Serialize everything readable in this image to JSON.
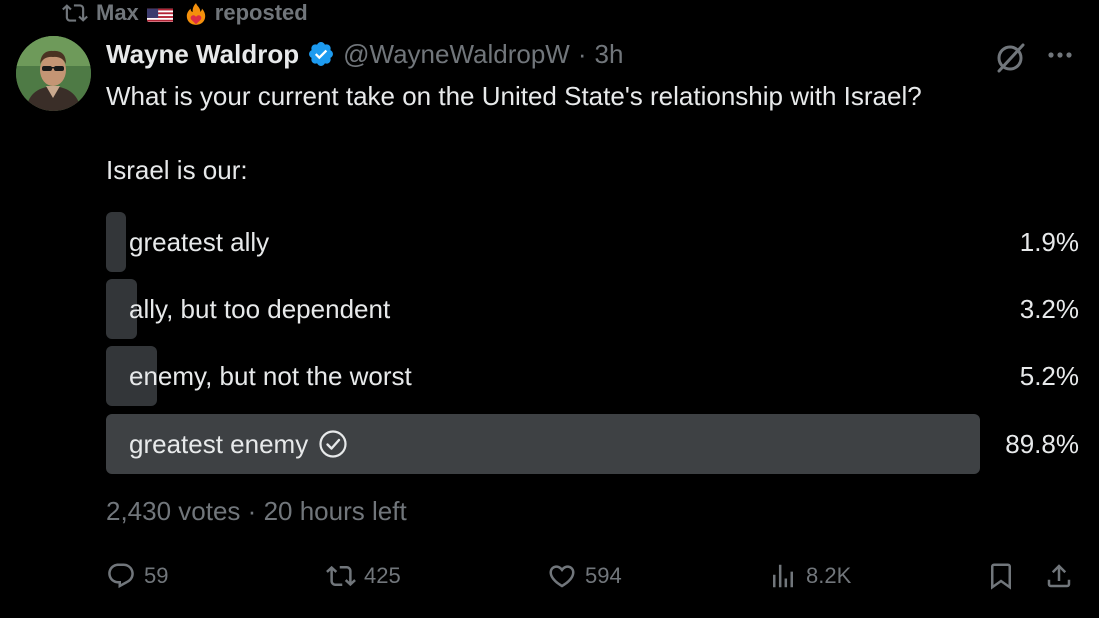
{
  "repost": {
    "user": "Max",
    "label": "reposted"
  },
  "author": {
    "display_name": "Wayne Waldrop",
    "handle": "@WayneWaldropW",
    "separator": "·",
    "time": "3h"
  },
  "tweet": {
    "line1": "What is your current take on the United State's relationship with Israel?",
    "line2": "Israel is our:"
  },
  "poll": {
    "options": [
      {
        "label": "greatest ally",
        "percent_text": "1.9%",
        "percent": 1.9,
        "winner": false
      },
      {
        "label": "ally, but too dependent",
        "percent_text": "3.2%",
        "percent": 3.2,
        "winner": false
      },
      {
        "label": "enemy, but not the worst",
        "percent_text": "5.2%",
        "percent": 5.2,
        "winner": false
      },
      {
        "label": "greatest enemy",
        "percent_text": "89.8%",
        "percent": 89.8,
        "winner": true
      }
    ],
    "votes": "2,430 votes",
    "separator": "·",
    "time_left": "20 hours left"
  },
  "actions": {
    "replies": "59",
    "reposts": "425",
    "likes": "594",
    "views": "8.2K"
  },
  "icons": {
    "repost": "repost-icon",
    "verified": "verified-badge-icon",
    "grok": "grok-icon",
    "more": "more-icon",
    "reply": "reply-icon",
    "like": "heart-icon",
    "views": "views-icon",
    "bookmark": "bookmark-icon",
    "share": "share-icon",
    "check": "check-circle-icon"
  },
  "colors": {
    "background": "#000000",
    "text": "#e7e9ea",
    "muted": "#71767b",
    "poll_bar": "#333639",
    "verified": "#1d9bf0"
  }
}
